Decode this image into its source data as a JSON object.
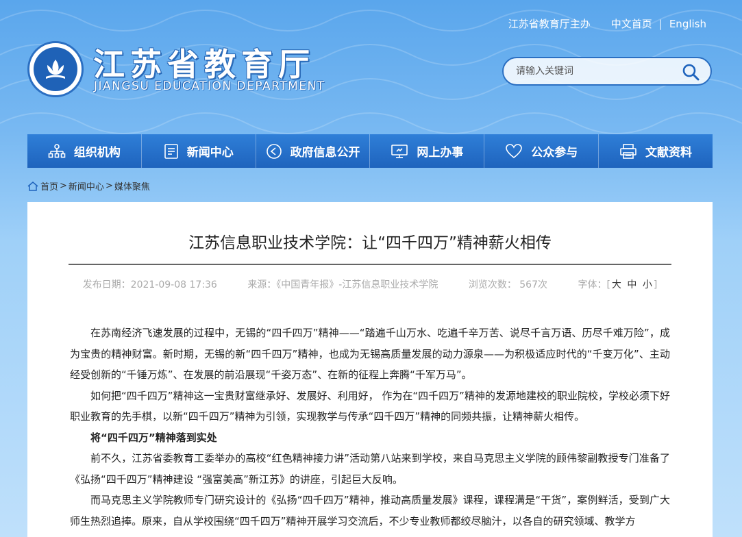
{
  "header": {
    "host": "江苏省教育厅主办",
    "cn_home": "中文首页",
    "separator": "|",
    "english": "English",
    "title_cn": "江苏省教育厅",
    "title_en": "JIANGSU EDUCATION DEPARTMENT",
    "search_placeholder": "请输入关键词"
  },
  "nav": [
    {
      "label": "组织机构",
      "icon": "org-chart-icon"
    },
    {
      "label": "新闻中心",
      "icon": "document-icon"
    },
    {
      "label": "政府信息公开",
      "icon": "play-circle-icon"
    },
    {
      "label": "网上办事",
      "icon": "monitor-icon"
    },
    {
      "label": "公众参与",
      "icon": "heart-icon"
    },
    {
      "label": "文献资料",
      "icon": "printer-icon"
    }
  ],
  "breadcrumb": {
    "home": "首页",
    "news": "新闻中心",
    "current": "媒体聚焦",
    "gt": ">"
  },
  "article": {
    "title": "江苏信息职业技术学院：让“四千四万”精神薪火相传",
    "publish_date": "发布日期：2021-09-08 17:36",
    "source": "来源：《中国青年报》-江苏信息职业技术学院",
    "views": "浏览次数：  567次",
    "font_label": "字体：[",
    "font_large": "大",
    "font_medium": "中",
    "font_small": "小",
    "font_end": "]",
    "paragraphs": [
      "在苏南经济飞速发展的过程中，无锡的“四千四万”精神——“踏遍千山万水、吃遍千辛万苦、说尽千言万语、历尽千难万险”，成为宝贵的精神财富。新时期，无锡的新“四千四万”精神，也成为无锡高质量发展的动力源泉——为积极适应时代的“千变万化”、主动经受创新的“千锤万炼”、在发展的前沿展现“千姿万态”、在新的征程上奔腾“千军万马”。",
      "如何把“四千四万”精神这一宝贵财富继承好、发展好、利用好， 作为在“四千四万”精神的发源地建校的职业院校，学校必须下好职业教育的先手棋，以新“四千四万”精神为引领，实现教学与传承“四千四万”精神的同频共振，让精神薪火相传。",
      "将“四千四万”精神落到实处",
      "前不久，江苏省委教育工委举办的高校“红色精神接力讲”活动第八站来到学校，来自马克思主义学院的顾伟黎副教授专门准备了《弘扬“四千四万”精神建设 “强富美高”新江苏》的讲座，引起巨大反响。",
      "而马克思主义学院教师专门研究设计的《弘扬“四千四万”精神，推动高质量发展》课程，课程满是“干货”，案例鲜活，受到广大师生热烈追捧。原来，自从学校围绕“四千四万”精神开展学习交流后，不少专业教师都绞尽脑汁，以各自的研究领域、教学方"
    ]
  }
}
